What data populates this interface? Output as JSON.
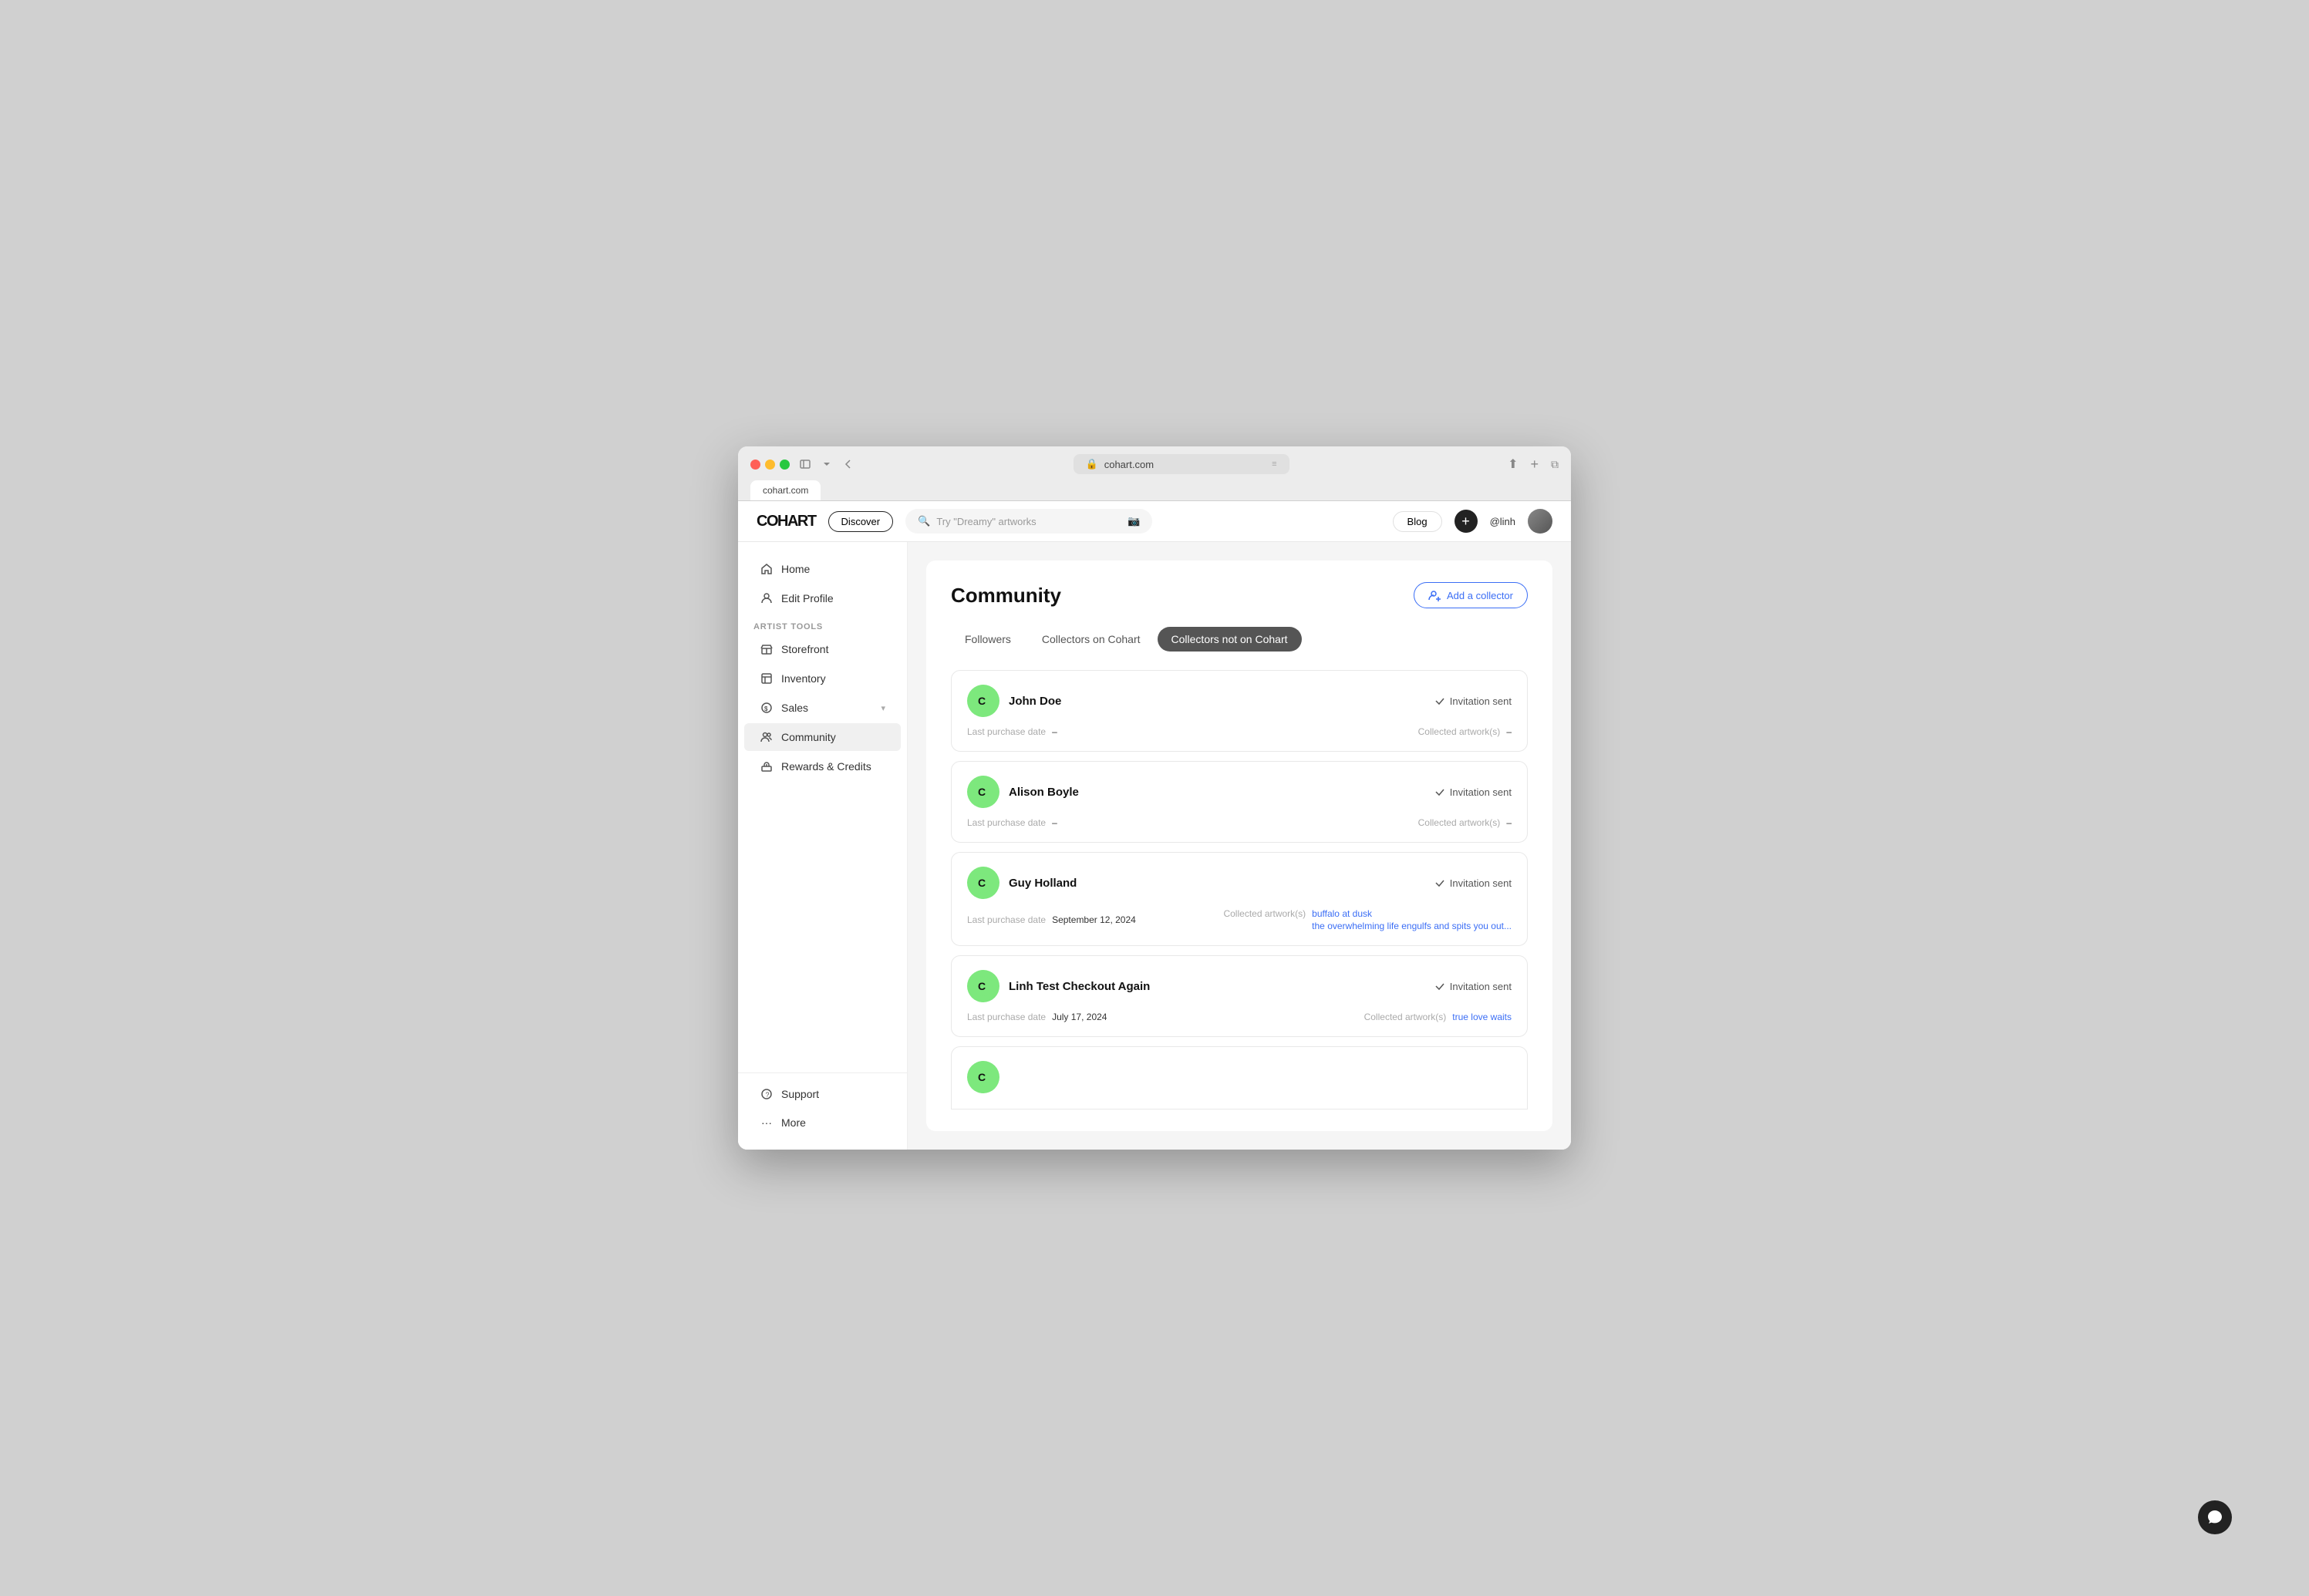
{
  "browser": {
    "url": "cohart.com",
    "tab_label": "cohart.com"
  },
  "topnav": {
    "logo": "COHART",
    "discover_label": "Discover",
    "search_placeholder": "Try \"Dreamy\" artworks",
    "blog_label": "Blog",
    "plus_icon": "+",
    "username": "@linh"
  },
  "sidebar": {
    "home_label": "Home",
    "edit_profile_label": "Edit Profile",
    "section_label": "ARTIST TOOLS",
    "storefront_label": "Storefront",
    "inventory_label": "Inventory",
    "sales_label": "Sales",
    "community_label": "Community",
    "rewards_label": "Rewards & Credits",
    "support_label": "Support",
    "more_label": "More"
  },
  "community": {
    "title": "Community",
    "add_collector_label": "Add a collector",
    "tabs": [
      {
        "label": "Followers",
        "active": false
      },
      {
        "label": "Collectors on Cohart",
        "active": false
      },
      {
        "label": "Collectors not on Cohart",
        "active": true
      }
    ],
    "collectors": [
      {
        "name": "John Doe",
        "last_purchase_label": "Last purchase date",
        "last_purchase_value": "–",
        "collected_label": "Collected artwork(s)",
        "collected_value": "–",
        "invitation_label": "Invitation sent",
        "artworks": []
      },
      {
        "name": "Alison Boyle",
        "last_purchase_label": "Last purchase date",
        "last_purchase_value": "–",
        "collected_label": "Collected artwork(s)",
        "collected_value": "–",
        "invitation_label": "Invitation sent",
        "artworks": []
      },
      {
        "name": "Guy Holland",
        "last_purchase_label": "Last purchase date",
        "last_purchase_value": "September 12, 2024",
        "collected_label": "Collected artwork(s)",
        "collected_value": "",
        "invitation_label": "Invitation sent",
        "artworks": [
          "buffalo at dusk",
          "the overwhelming life engulfs and spits you out..."
        ]
      },
      {
        "name": "Linh Test Checkout Again",
        "last_purchase_label": "Last purchase date",
        "last_purchase_value": "July 17, 2024",
        "collected_label": "Collected artwork(s)",
        "collected_value": "",
        "invitation_label": "Invitation sent",
        "artworks": [
          "true love waits"
        ]
      }
    ]
  }
}
